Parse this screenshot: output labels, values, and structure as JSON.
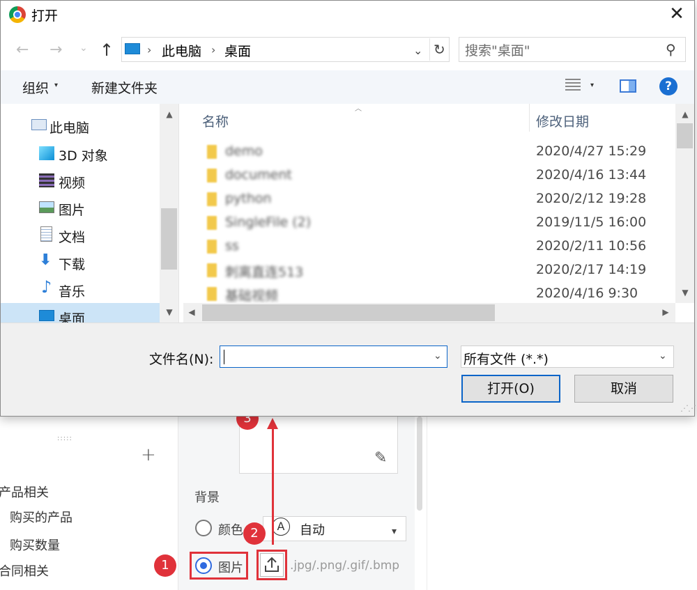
{
  "background_app": {
    "tree": {
      "group1": "产品相关",
      "item1": "购买的产品",
      "item2": "购买数量",
      "group2": "合同相关"
    },
    "section_label": "背景",
    "radio_color": "颜色",
    "radio_image": "图片",
    "auto_label": "自动",
    "auto_glyph": "A",
    "file_hint": ".jpg/.png/.gif/.bmp",
    "callouts": [
      "1",
      "2",
      "3"
    ]
  },
  "dialog": {
    "title": "打开",
    "address": [
      "此电脑",
      "桌面"
    ],
    "search_placeholder": "搜索\"桌面\"",
    "toolbar": {
      "organize": "组织",
      "new_folder": "新建文件夹"
    },
    "nav_items": [
      {
        "label": "此电脑",
        "icon": "computer-icon"
      },
      {
        "label": "3D 对象",
        "icon": "cube-icon"
      },
      {
        "label": "视频",
        "icon": "video-icon"
      },
      {
        "label": "图片",
        "icon": "picture-icon"
      },
      {
        "label": "文档",
        "icon": "document-icon"
      },
      {
        "label": "下载",
        "icon": "download-icon"
      },
      {
        "label": "音乐",
        "icon": "music-icon"
      },
      {
        "label": "桌面",
        "icon": "desktop-icon"
      }
    ],
    "columns": {
      "name": "名称",
      "modified": "修改日期"
    },
    "files": [
      {
        "name": "demo",
        "date": "2020/4/27 15:29"
      },
      {
        "name": "document",
        "date": "2020/4/16 13:44"
      },
      {
        "name": "python",
        "date": "2020/2/12 19:28"
      },
      {
        "name": "SingleFile (2)",
        "date": "2019/11/5 16:00"
      },
      {
        "name": "ss",
        "date": "2020/2/11 10:56"
      },
      {
        "name": "刺离直连513",
        "date": "2020/2/17 14:19"
      },
      {
        "name": "基础视频",
        "date": "2020/4/16 9:30"
      }
    ],
    "filename_label": "文件名(N):",
    "filename_value": "",
    "filter_value": "所有文件 (*.*)",
    "open_button": "打开(O)",
    "cancel_button": "取消"
  }
}
